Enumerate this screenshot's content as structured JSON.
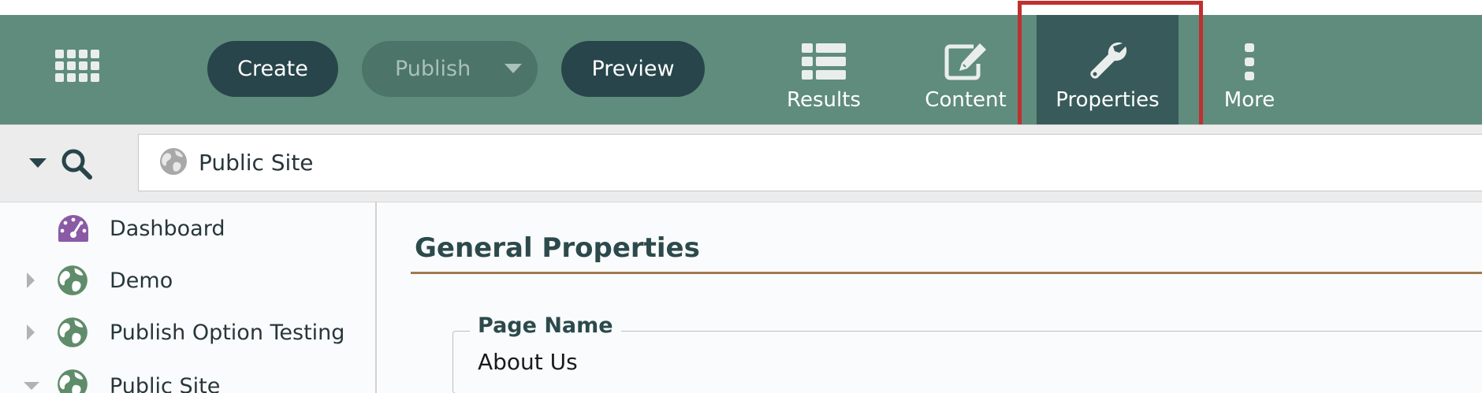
{
  "toolbar": {
    "create_label": "Create",
    "publish_label": "Publish",
    "preview_label": "Preview",
    "nav": [
      {
        "label": "Results",
        "icon": "list-icon"
      },
      {
        "label": "Content",
        "icon": "edit-icon"
      },
      {
        "label": "Properties",
        "icon": "wrench-icon",
        "active": true
      },
      {
        "label": "More",
        "icon": "more-vertical-icon"
      }
    ]
  },
  "search": {
    "site_value": "Public Site"
  },
  "sidebar": {
    "items": [
      {
        "label": "Dashboard",
        "icon": "dashboard-icon"
      },
      {
        "label": "Demo",
        "icon": "globe-icon"
      },
      {
        "label": "Publish Option Testing",
        "icon": "globe-icon"
      },
      {
        "label": "Public Site",
        "icon": "globe-icon"
      }
    ]
  },
  "main": {
    "section_title": "General Properties",
    "page_name_label": "Page Name",
    "page_name_value": "About Us"
  },
  "colors": {
    "toolbar_bg": "#5f8c7c",
    "dark_button": "#27454a",
    "active_tab": "#385a5a",
    "highlight_box": "#c0302f",
    "section_rule": "#a07a52",
    "dashboard_icon": "#8a5aa5",
    "globe_icon": "#5f8c6a"
  }
}
